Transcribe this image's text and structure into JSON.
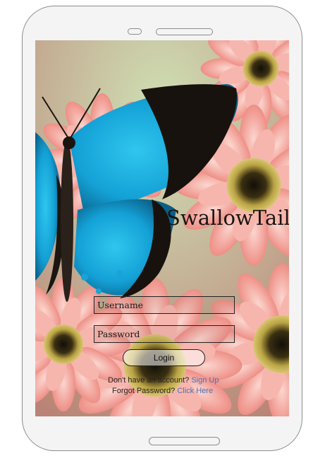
{
  "app": {
    "title": "SwallowTail"
  },
  "login_form": {
    "username_placeholder": "Username",
    "password_placeholder": "Password",
    "login_label": "Login"
  },
  "signup": {
    "prompt": "Don't have an account?",
    "link": "Sign Up"
  },
  "forgot": {
    "prompt": "Forgot Password?",
    "link": "Click Here"
  },
  "colors": {
    "link": "#4f6fb8",
    "butterfly_blue": "#1aa3d9",
    "flower_pink": "#f2a09a"
  }
}
